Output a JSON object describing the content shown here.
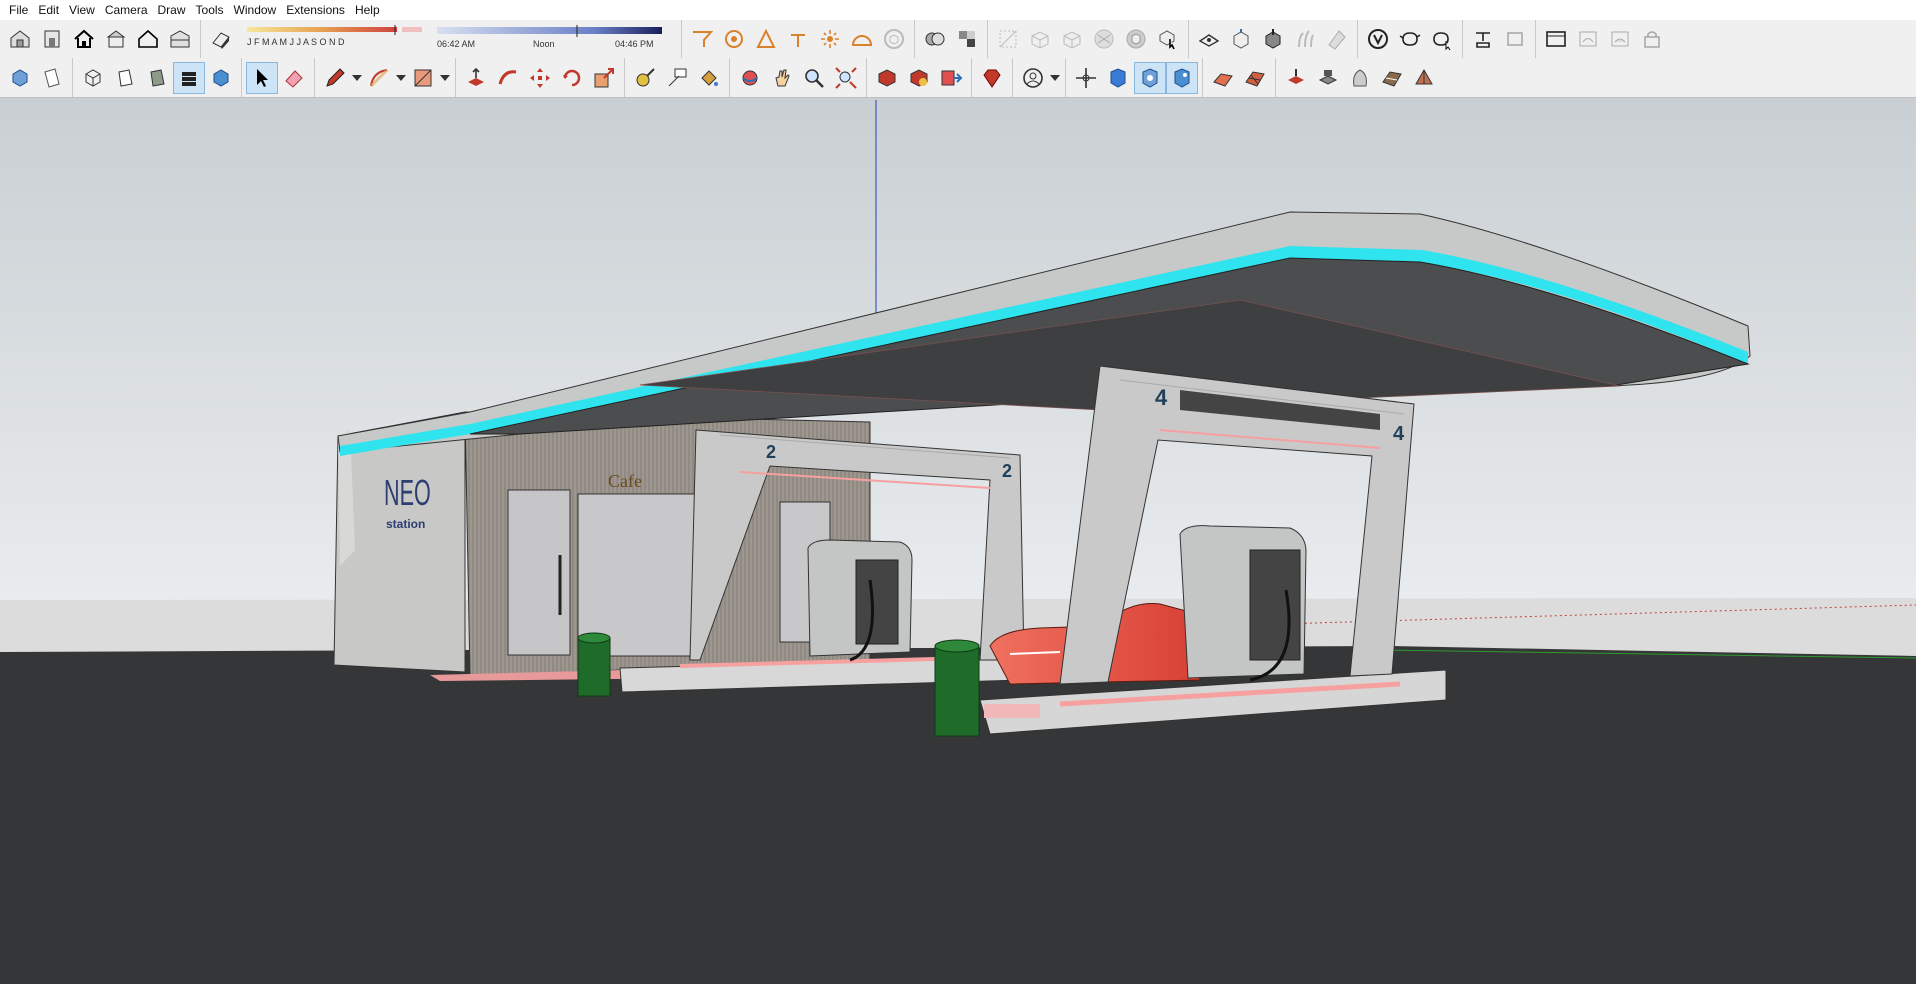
{
  "menu": [
    "File",
    "Edit",
    "View",
    "Camera",
    "Draw",
    "Tools",
    "Window",
    "Extensions",
    "Help"
  ],
  "shadow_settings": {
    "months": "J F M A M J J A S O N D",
    "time_start": "06:42 AM",
    "time_mid": "Noon",
    "time_end": "04:46 PM"
  },
  "model": {
    "cafe_sign": "Cafe",
    "brand_title": "NEO",
    "brand_sub": "station",
    "pump_number_left": "2",
    "pump_number_right": "4"
  },
  "colors": {
    "sky_top": "#c9cfd3",
    "sky_bottom": "#e9ecee",
    "ground": "#353637",
    "neon": "#2fe4ee",
    "canopy": "#c7c9c9",
    "accent_pink": "#f6a0a0",
    "car": "#e8564d",
    "bin": "#1f6b2a"
  },
  "icons": {
    "toolbar1": [
      "iso-view-icon",
      "front-view-icon",
      "home-icon",
      "top-view-icon",
      "house-outline-icon",
      "side-view-icon",
      "shadow-toggle-icon",
      "flat-icon",
      "soften-icon",
      "section-plane-icon",
      "text-tool-icon",
      "sun-icon",
      "arc-icon",
      "cube-icon",
      "layer-icon",
      "component-icon",
      "face-style-1-icon",
      "face-style-2-icon",
      "face-style-3-icon",
      "face-style-4-icon",
      "face-style-5-icon",
      "interact-icon",
      "warehouse-icon",
      "box-up-icon",
      "box-down-icon",
      "grass-icon",
      "shade-icon",
      "vray-icon",
      "teapot-icon",
      "teapot-hand-icon",
      "light-icon",
      "light-alt-icon",
      "window-icon",
      "render-icon",
      "render-alt-icon",
      "lock-icon"
    ],
    "toolbar2": [
      "iso-cube-icon",
      "paper-icon",
      "wire-cube-icon",
      "hidden-line-icon",
      "shaded-icon",
      "textured-icon",
      "monochrome-icon",
      "select-arrow-icon",
      "eraser-icon",
      "pencil-icon",
      "arc-tool-icon",
      "rectangle-icon",
      "push-pull-icon",
      "follow-me-icon",
      "move-icon",
      "rotate-icon",
      "scale-icon",
      "tape-measure-icon",
      "dimension-icon",
      "paint-bucket-icon",
      "orbit-icon",
      "pan-icon",
      "zoom-icon",
      "zoom-extents-icon",
      "warehouse-3d-icon",
      "extension-warehouse-icon",
      "send-layout-icon",
      "ruby-icon",
      "account-icon",
      "axes-icon",
      "x-ray-icon",
      "back-edges-icon",
      "wireframe-icon",
      "sandbox-icon",
      "grid-icon",
      "stamp-icon",
      "drape-icon",
      "add-detail-icon",
      "flip-edge-icon",
      "smoove-icon"
    ]
  }
}
